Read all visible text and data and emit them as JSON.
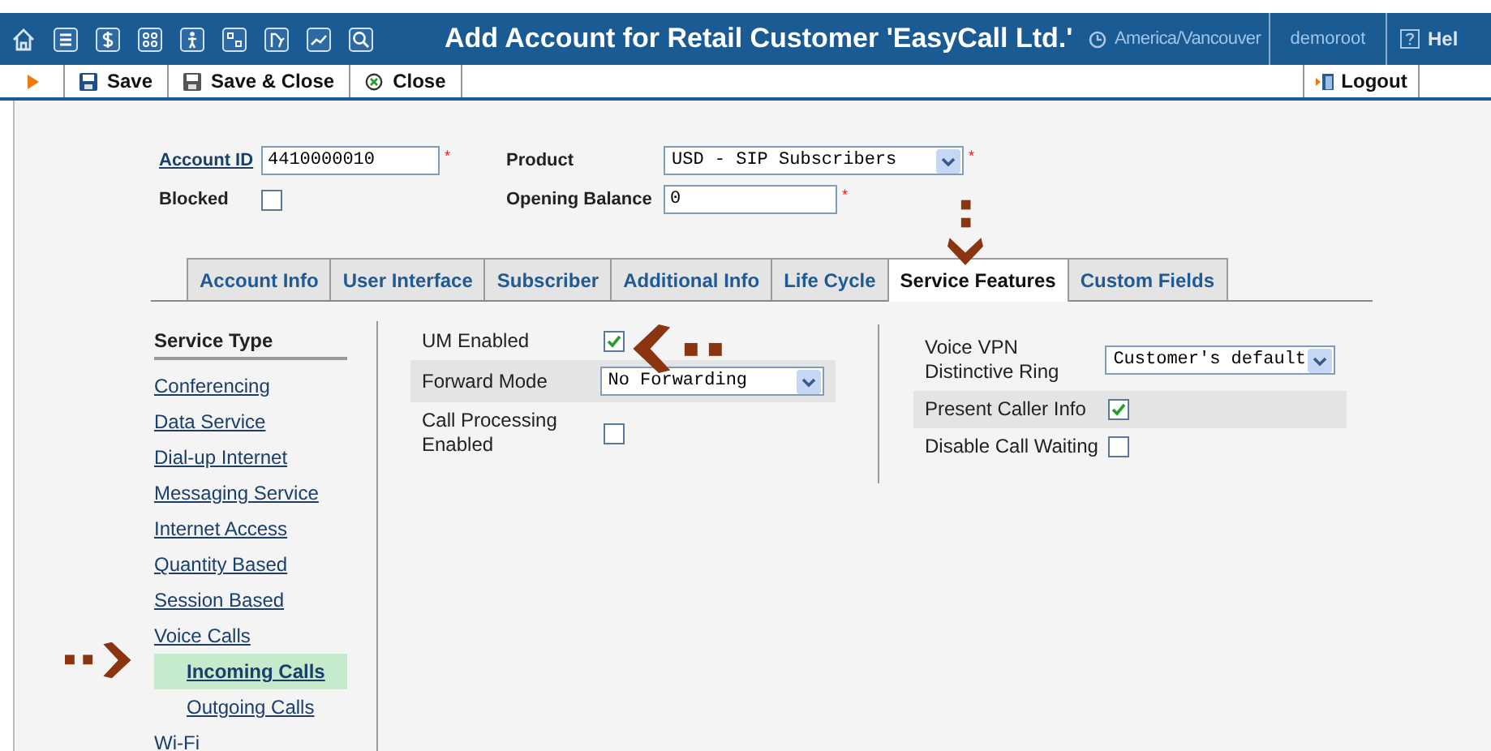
{
  "header": {
    "title": "Add Account for Retail Customer 'EasyCall Ltd.'",
    "timezone": "America/Vancouver",
    "user": "demoroot",
    "help": "Hel"
  },
  "toolbar": {
    "buttons": [
      {
        "label": "Save",
        "kind": "save"
      },
      {
        "label": "Save & Close",
        "kind": "save_close"
      },
      {
        "label": "Close",
        "kind": "close"
      }
    ],
    "logout": "Logout"
  },
  "fields": [
    {
      "label": "Account ID",
      "kind": "text",
      "value": "4410000010",
      "mark": "*",
      "link": true
    },
    {
      "label": "Product",
      "kind": "select",
      "value": "USD - SIP Subscribers",
      "mark": "*",
      "link": false
    },
    {
      "label": "Blocked",
      "kind": "checkbox",
      "checked": false,
      "link": false
    },
    {
      "label": "Opening Balance",
      "kind": "text",
      "value": "0",
      "mark": "*",
      "link": false
    }
  ],
  "tabs": [
    {
      "label": "Account Info",
      "selected": false
    },
    {
      "label": "User Interface",
      "selected": false
    },
    {
      "label": "Subscriber",
      "selected": false
    },
    {
      "label": "Additional Info",
      "selected": false
    },
    {
      "label": "Life Cycle",
      "selected": false
    },
    {
      "label": "Service Features",
      "selected": true
    },
    {
      "label": "Custom Fields",
      "selected": false
    }
  ],
  "service_types": {
    "title": "Service Type",
    "items": [
      {
        "label": "Conferencing",
        "selected": false
      },
      {
        "label": "Data Service",
        "selected": false
      },
      {
        "label": "Dial-up Internet",
        "selected": false
      },
      {
        "label": "Messaging Service",
        "selected": false
      },
      {
        "label": "Internet Access",
        "selected": false
      },
      {
        "label": "Quantity Based",
        "selected": false
      },
      {
        "label": "Session Based",
        "selected": false
      },
      {
        "label": "Voice Calls",
        "selected": false,
        "children": [
          {
            "label": "Incoming Calls",
            "selected": true
          },
          {
            "label": "Outgoing Calls",
            "selected": false
          }
        ]
      },
      {
        "label": "Wi-Fi",
        "selected": false
      }
    ]
  },
  "features_left": [
    {
      "label": "UM Enabled",
      "kind": "checkbox",
      "checked": true
    },
    {
      "label": "Forward Mode",
      "kind": "select",
      "value": "No Forwarding"
    },
    {
      "label": "Call Processing Enabled",
      "kind": "checkbox",
      "checked": false
    }
  ],
  "features_right": [
    {
      "label": "Voice VPN Distinctive Ring",
      "kind": "select",
      "value": "Customer's default"
    },
    {
      "label": "Present Caller Info",
      "kind": "checkbox",
      "checked": true
    },
    {
      "label": "Disable Call Waiting",
      "kind": "checkbox",
      "checked": false
    }
  ]
}
